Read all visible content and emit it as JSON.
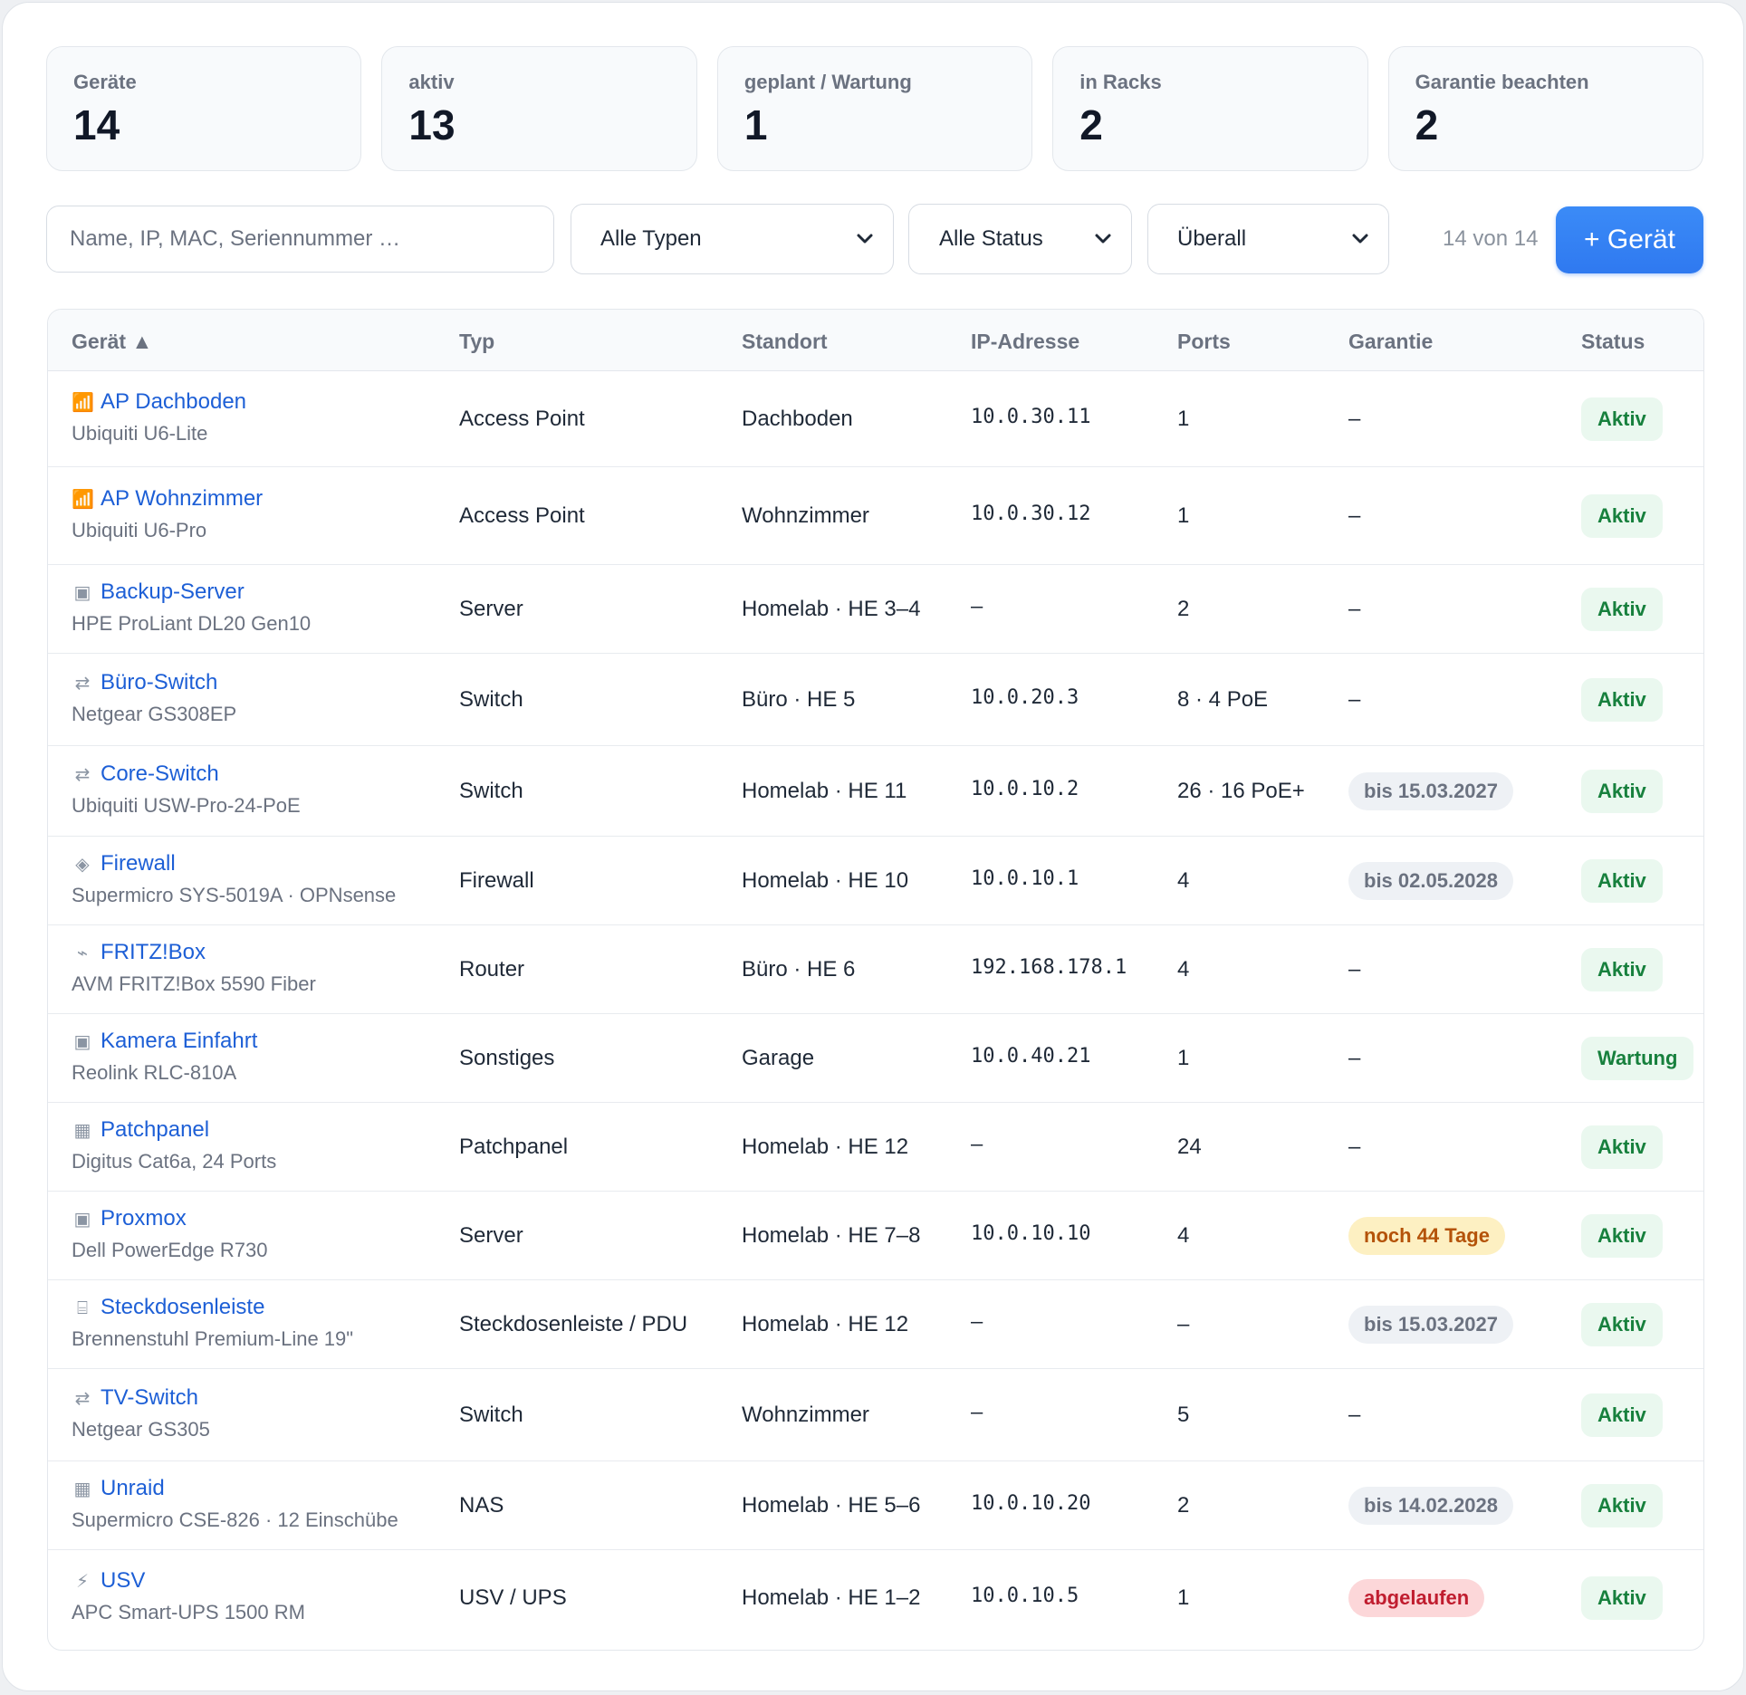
{
  "stats": [
    {
      "label": "Geräte",
      "value": "14"
    },
    {
      "label": "aktiv",
      "value": "13"
    },
    {
      "label": "geplant / Wartung",
      "value": "1"
    },
    {
      "label": "in Racks",
      "value": "2"
    },
    {
      "label": "Garantie beachten",
      "value": "2"
    }
  ],
  "filters": {
    "search_placeholder": "Name, IP, MAC, Seriennummer …",
    "type_select": "Alle Typen",
    "status_select": "Alle Status",
    "location_select": "Überall",
    "count": "14 von 14",
    "add_button": "+ Gerät"
  },
  "table": {
    "headers": {
      "device": "Gerät ▲",
      "type": "Typ",
      "location": "Standort",
      "ip": "IP-Adresse",
      "ports": "Ports",
      "warranty": "Garantie",
      "status": "Status"
    },
    "rows": [
      {
        "icon": "📶",
        "icon_name": "signal-bars-icon",
        "name": "AP Dachboden",
        "model": "Ubiquiti U6-Lite",
        "type": "Access Point",
        "location": "Dachboden",
        "ip": "10.0.30.11",
        "ports": "1",
        "warranty": "–",
        "warranty_style": "none",
        "status": "Aktiv"
      },
      {
        "icon": "📶",
        "icon_name": "signal-bars-icon",
        "name": "AP Wohnzimmer",
        "model": "Ubiquiti U6-Pro",
        "type": "Access Point",
        "location": "Wohnzimmer",
        "ip": "10.0.30.12",
        "ports": "1",
        "warranty": "–",
        "warranty_style": "none",
        "status": "Aktiv"
      },
      {
        "icon": "▣",
        "icon_name": "server-icon",
        "name": "Backup-Server",
        "model": "HPE ProLiant DL20 Gen10",
        "type": "Server",
        "location": "Homelab · HE 3–4",
        "ip": "–",
        "ports": "2",
        "warranty": "–",
        "warranty_style": "none",
        "status": "Aktiv"
      },
      {
        "icon": "⇄",
        "icon_name": "switch-arrows-icon",
        "name": "Büro-Switch",
        "model": "Netgear GS308EP",
        "type": "Switch",
        "location": "Büro · HE 5",
        "ip": "10.0.20.3",
        "ports": "8 · 4 PoE",
        "warranty": "–",
        "warranty_style": "none",
        "status": "Aktiv"
      },
      {
        "icon": "⇄",
        "icon_name": "switch-arrows-icon",
        "name": "Core-Switch",
        "model": "Ubiquiti USW-Pro-24-PoE",
        "type": "Switch",
        "location": "Homelab · HE 11",
        "ip": "10.0.10.2",
        "ports": "26 · 16 PoE+",
        "warranty": "bis 15.03.2027",
        "warranty_style": "gray",
        "status": "Aktiv"
      },
      {
        "icon": "◈",
        "icon_name": "firewall-diamond-icon",
        "name": "Firewall",
        "model": "Supermicro SYS-5019A · OPNsense",
        "type": "Firewall",
        "location": "Homelab · HE 10",
        "ip": "10.0.10.1",
        "ports": "4",
        "warranty": "bis 02.05.2028",
        "warranty_style": "gray",
        "status": "Aktiv"
      },
      {
        "icon": "⌁",
        "icon_name": "router-icon",
        "name": "FRITZ!Box",
        "model": "AVM FRITZ!Box 5590 Fiber",
        "type": "Router",
        "location": "Büro · HE 6",
        "ip": "192.168.178.1",
        "ports": "4",
        "warranty": "–",
        "warranty_style": "none",
        "status": "Aktiv"
      },
      {
        "icon": "▣",
        "icon_name": "device-box-icon",
        "name": "Kamera Einfahrt",
        "model": "Reolink RLC-810A",
        "type": "Sonstiges",
        "location": "Garage",
        "ip": "10.0.40.21",
        "ports": "1",
        "warranty": "–",
        "warranty_style": "none",
        "status": "Wartung"
      },
      {
        "icon": "▦",
        "icon_name": "patchpanel-icon",
        "name": "Patchpanel",
        "model": "Digitus Cat6a, 24 Ports",
        "type": "Patchpanel",
        "location": "Homelab · HE 12",
        "ip": "–",
        "ports": "24",
        "warranty": "–",
        "warranty_style": "none",
        "status": "Aktiv"
      },
      {
        "icon": "▣",
        "icon_name": "server-icon",
        "name": "Proxmox",
        "model": "Dell PowerEdge R730",
        "type": "Server",
        "location": "Homelab · HE 7–8",
        "ip": "10.0.10.10",
        "ports": "4",
        "warranty": "noch 44 Tage",
        "warranty_style": "amber",
        "status": "Aktiv"
      },
      {
        "icon": "⌸",
        "icon_name": "power-strip-icon",
        "name": "Steckdosenleiste",
        "model": "Brennenstuhl Premium-Line 19\"",
        "type": "Steckdosenleiste / PDU",
        "location": "Homelab · HE 12",
        "ip": "–",
        "ports": "–",
        "warranty": "bis 15.03.2027",
        "warranty_style": "gray",
        "status": "Aktiv"
      },
      {
        "icon": "⇄",
        "icon_name": "switch-arrows-icon",
        "name": "TV-Switch",
        "model": "Netgear GS305",
        "type": "Switch",
        "location": "Wohnzimmer",
        "ip": "–",
        "ports": "5",
        "warranty": "–",
        "warranty_style": "none",
        "status": "Aktiv"
      },
      {
        "icon": "▦",
        "icon_name": "nas-icon",
        "name": "Unraid",
        "model": "Supermicro CSE-826 · 12 Einschübe",
        "type": "NAS",
        "location": "Homelab · HE 5–6",
        "ip": "10.0.10.20",
        "ports": "2",
        "warranty": "bis 14.02.2028",
        "warranty_style": "gray",
        "status": "Aktiv"
      },
      {
        "icon": "⚡",
        "icon_name": "lightning-icon",
        "name": "USV",
        "model": "APC Smart-UPS 1500 RM",
        "type": "USV / UPS",
        "location": "Homelab · HE 1–2",
        "ip": "10.0.10.5",
        "ports": "1",
        "warranty": "abgelaufen",
        "warranty_style": "red",
        "status": "Aktiv"
      }
    ]
  }
}
